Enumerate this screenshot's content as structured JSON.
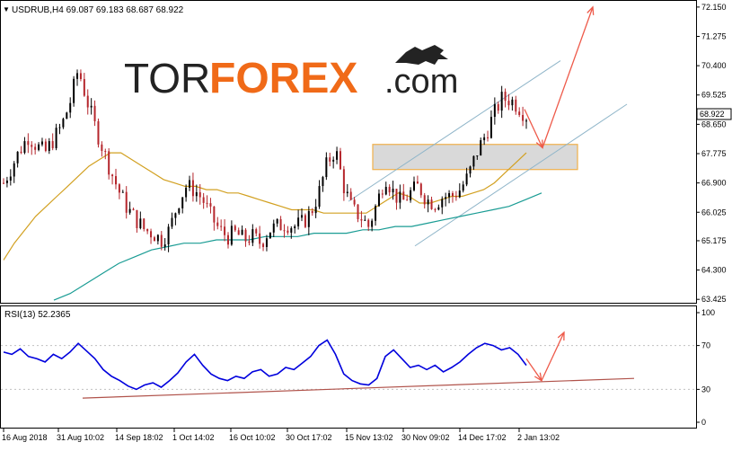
{
  "header": {
    "symbol_line": "USDRUB,H4  69.087 69.183 68.687 68.922",
    "rsi_label": "RSI(13) 52.2365"
  },
  "watermark": {
    "tor": "TOR",
    "forex": "FOREX",
    "com": ".com"
  },
  "colors": {
    "bull_candle": "#000000",
    "bear_candle": "#b5262c",
    "ma_fast": "#d2a020",
    "ma_slow": "#1a9c94",
    "channel": "#8fb5c9",
    "forecast": "#ee5a4a",
    "zone_fill": "#d9d9d9",
    "zone_border": "#f0b04a",
    "rsi_line": "#0000dd",
    "rsi_trend": "#b0524a",
    "price_label_bg": "#ffffff",
    "logo_orange": "#f06a18",
    "logo_dark": "#232323"
  },
  "chart_data": [
    {
      "type": "candlestick",
      "title": "USDRUB,H4",
      "ohlc_last": {
        "open": 69.087,
        "high": 69.183,
        "low": 68.687,
        "close": 68.922
      },
      "last_price_label": "68.922",
      "ylim": [
        63.35,
        72.2
      ],
      "y_ticks": [
        "72.150",
        "71.275",
        "70.400",
        "69.525",
        "68.650",
        "67.775",
        "66.900",
        "66.025",
        "65.175",
        "64.300",
        "63.425"
      ],
      "x_ticks": [
        "16 Aug 2018",
        "31 Aug 10:02",
        "14 Sep 18:02",
        "1 Oct 14:02",
        "16 Oct 10:02",
        "30 Oct 17:02",
        "15 Nov 13:02",
        "30 Nov 09:02",
        "14 Dec 17:02",
        "2 Jan 13:02"
      ],
      "close_series": [
        {
          "x": "16 Aug 2018",
          "y": 66.9
        },
        {
          "x": "",
          "y": 67.4
        },
        {
          "x": "",
          "y": 67.9
        },
        {
          "x": "",
          "y": 68.3
        },
        {
          "x": "",
          "y": 68.0
        },
        {
          "x": "",
          "y": 67.8
        },
        {
          "x": "",
          "y": 68.2
        },
        {
          "x": "",
          "y": 68.6
        },
        {
          "x": "31 Aug 10:02",
          "y": 69.3
        },
        {
          "x": "",
          "y": 70.3
        },
        {
          "x": "",
          "y": 69.4
        },
        {
          "x": "",
          "y": 68.6
        },
        {
          "x": "",
          "y": 67.9
        },
        {
          "x": "",
          "y": 67.2
        },
        {
          "x": "",
          "y": 66.6
        },
        {
          "x": "",
          "y": 66.1
        },
        {
          "x": "14 Sep 18:02",
          "y": 65.8
        },
        {
          "x": "",
          "y": 65.5
        },
        {
          "x": "",
          "y": 65.4
        },
        {
          "x": "",
          "y": 65.2
        },
        {
          "x": "",
          "y": 65.5
        },
        {
          "x": "",
          "y": 66.3
        },
        {
          "x": "",
          "y": 66.8
        },
        {
          "x": "1 Oct 14:02",
          "y": 66.7
        },
        {
          "x": "",
          "y": 66.4
        },
        {
          "x": "",
          "y": 65.9
        },
        {
          "x": "",
          "y": 65.5
        },
        {
          "x": "",
          "y": 65.3
        },
        {
          "x": "",
          "y": 65.4
        },
        {
          "x": "",
          "y": 65.2
        },
        {
          "x": "16 Oct 10:02",
          "y": 65.3
        },
        {
          "x": "",
          "y": 65.1
        },
        {
          "x": "",
          "y": 65.5
        },
        {
          "x": "",
          "y": 65.6
        },
        {
          "x": "",
          "y": 65.7
        },
        {
          "x": "",
          "y": 65.6
        },
        {
          "x": "",
          "y": 65.7
        },
        {
          "x": "",
          "y": 66.0
        },
        {
          "x": "30 Oct 17:02",
          "y": 66.6
        },
        {
          "x": "",
          "y": 67.5
        },
        {
          "x": "",
          "y": 67.9
        },
        {
          "x": "",
          "y": 66.8
        },
        {
          "x": "",
          "y": 66.1
        },
        {
          "x": "",
          "y": 65.9
        },
        {
          "x": "15 Nov 13:02",
          "y": 65.6
        },
        {
          "x": "",
          "y": 66.3
        },
        {
          "x": "",
          "y": 67.1
        },
        {
          "x": "",
          "y": 66.6
        },
        {
          "x": "",
          "y": 66.3
        },
        {
          "x": "",
          "y": 66.6
        },
        {
          "x": "",
          "y": 66.8
        },
        {
          "x": "30 Nov 09:02",
          "y": 66.4
        },
        {
          "x": "",
          "y": 66.3
        },
        {
          "x": "",
          "y": 66.5
        },
        {
          "x": "",
          "y": 66.5
        },
        {
          "x": "",
          "y": 66.7
        },
        {
          "x": "",
          "y": 67.1
        },
        {
          "x": "",
          "y": 67.8
        },
        {
          "x": "14 Dec 17:02",
          "y": 68.3
        },
        {
          "x": "",
          "y": 68.9
        },
        {
          "x": "",
          "y": 69.4
        },
        {
          "x": "",
          "y": 69.4
        },
        {
          "x": "",
          "y": 69.2
        },
        {
          "x": "2 Jan 13:02",
          "y": 68.9
        }
      ],
      "ma_fast_series": [
        64.6,
        65.1,
        65.5,
        65.9,
        66.2,
        66.5,
        66.8,
        67.1,
        67.4,
        67.6,
        67.8,
        67.8,
        67.6,
        67.4,
        67.2,
        67.0,
        66.9,
        66.8,
        66.8,
        66.7,
        66.7,
        66.6,
        66.6,
        66.5,
        66.4,
        66.3,
        66.2,
        66.1,
        66.1,
        66.1,
        66.0,
        66.0,
        66.0,
        66.0,
        66.0,
        66.2,
        66.4,
        66.6,
        66.5,
        66.3,
        66.3,
        66.4,
        66.5,
        66.5,
        66.6,
        66.7,
        66.9,
        67.2,
        67.5,
        67.8
      ],
      "ma_slow_series": [
        63.4,
        63.6,
        63.9,
        64.2,
        64.5,
        64.7,
        64.9,
        65.0,
        65.1,
        65.1,
        65.2,
        65.2,
        65.2,
        65.3,
        65.3,
        65.3,
        65.4,
        65.4,
        65.4,
        65.5,
        65.5,
        65.6,
        65.6,
        65.7,
        65.8,
        65.9,
        66.0,
        66.1,
        66.2,
        66.4,
        66.6
      ],
      "zone": {
        "from": 67.3,
        "to": 68.05
      }
    },
    {
      "type": "line",
      "title": "RSI(13) 52.2365",
      "ylim": [
        0,
        100
      ],
      "y_ticks": [
        "100",
        "70",
        "30",
        "0"
      ],
      "rsi_series": [
        64,
        62,
        67,
        60,
        58,
        55,
        62,
        58,
        64,
        72,
        65,
        58,
        48,
        42,
        38,
        33,
        30,
        34,
        36,
        32,
        38,
        45,
        55,
        62,
        52,
        44,
        40,
        38,
        42,
        40,
        46,
        48,
        42,
        44,
        50,
        48,
        54,
        60,
        70,
        75,
        62,
        44,
        38,
        35,
        34,
        40,
        60,
        66,
        58,
        50,
        52,
        48,
        52,
        46,
        50,
        55,
        62,
        68,
        72,
        70,
        66,
        68,
        62,
        52
      ],
      "trendline": {
        "from": 22,
        "to": 40
      }
    }
  ]
}
